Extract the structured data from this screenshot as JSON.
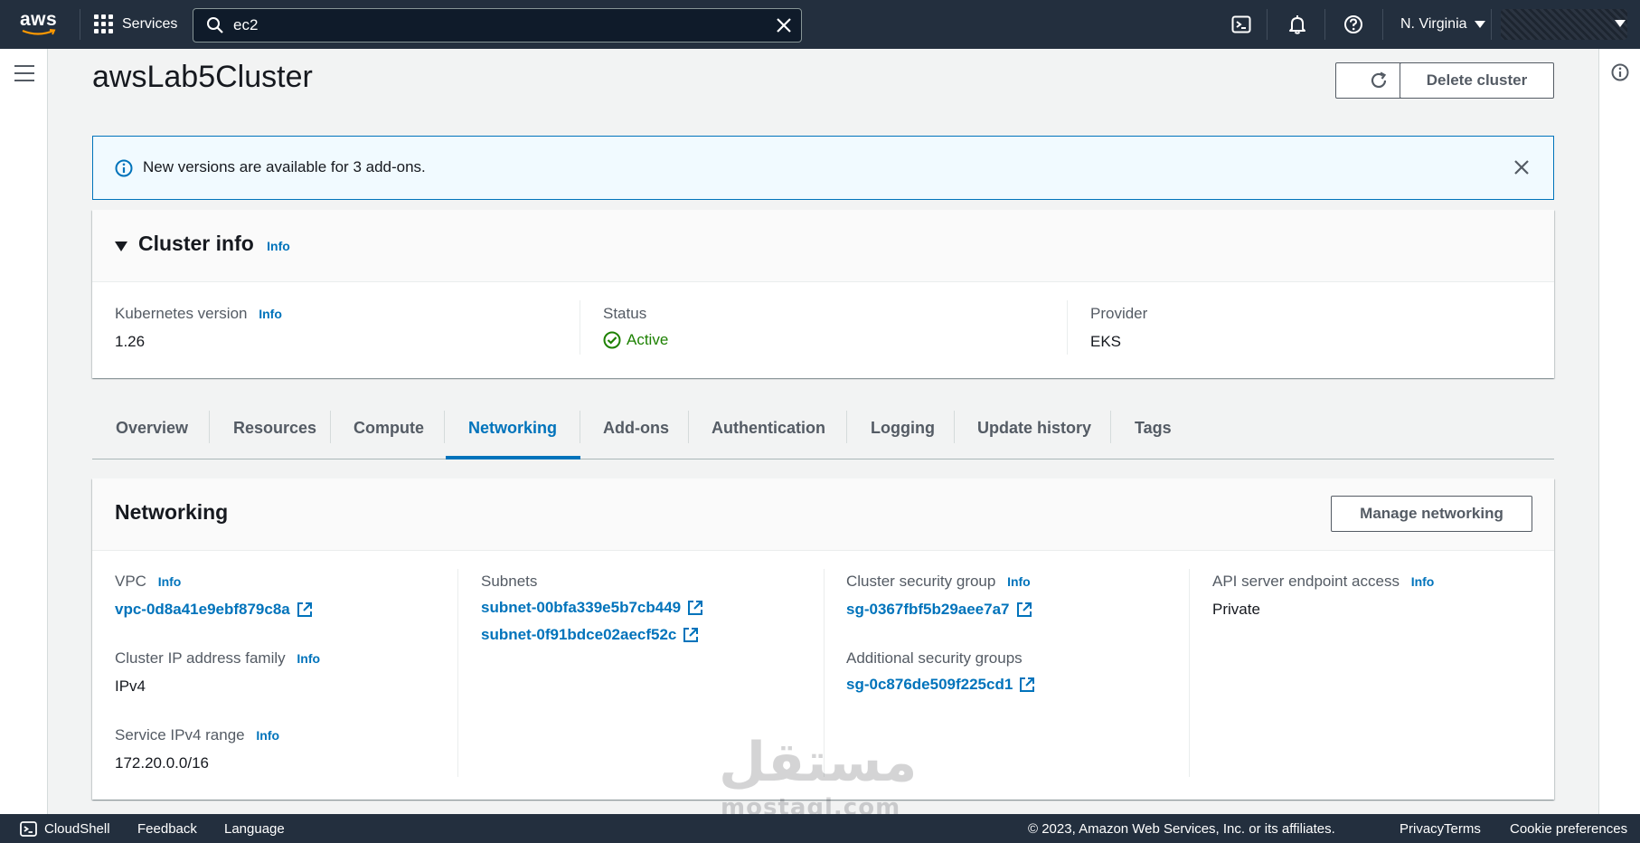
{
  "topnav": {
    "logo_text": "aws",
    "services_label": "Services",
    "search_value": "ec2",
    "region": "N. Virginia"
  },
  "page": {
    "title": "awsLab5Cluster",
    "delete_button": "Delete cluster"
  },
  "flash": {
    "message": "New versions are available for 3 add-ons."
  },
  "cluster_info": {
    "title": "Cluster info",
    "info": "Info",
    "k8s_label": "Kubernetes version",
    "k8s_value": "1.26",
    "status_label": "Status",
    "status_value": "Active",
    "provider_label": "Provider",
    "provider_value": "EKS"
  },
  "tabs": [
    "Overview",
    "Resources",
    "Compute",
    "Networking",
    "Add-ons",
    "Authentication",
    "Logging",
    "Update history",
    "Tags"
  ],
  "networking": {
    "title": "Networking",
    "manage_button": "Manage networking",
    "info": "Info",
    "vpc_label": "VPC",
    "vpc_value": "vpc-0d8a41e9ebf879c8a",
    "ip_family_label": "Cluster IP address family",
    "ip_family_value": "IPv4",
    "service_range_label": "Service IPv4 range",
    "service_range_value": "172.20.0.0/16",
    "subnets_label": "Subnets",
    "subnets": [
      "subnet-00bfa339e5b7cb449",
      "subnet-0f91bdce02aecf52c"
    ],
    "sg_label": "Cluster security group",
    "sg_value": "sg-0367fbf5b29aee7a7",
    "additional_sg_label": "Additional security groups",
    "additional_sg_value": "sg-0c876de509f225cd1",
    "api_label": "API server endpoint access",
    "api_value": "Private"
  },
  "footer": {
    "cloudshell": "CloudShell",
    "feedback": "Feedback",
    "language": "Language",
    "copyright": "© 2023, Amazon Web Services, Inc. or its affiliates.",
    "privacy": "Privacy",
    "terms": "Terms",
    "cookies": "Cookie preferences"
  },
  "watermark": {
    "arabic": "مستقل",
    "latin": "mostaql.com"
  },
  "colors": {
    "nav_bg": "#232f3e",
    "link": "#0073bb",
    "success": "#1d8102",
    "flash_bg": "#f1faff"
  },
  "icons": [
    "aws-logo",
    "grid-icon",
    "search-icon",
    "clear-icon",
    "cloudshell-icon",
    "bell-icon",
    "help-icon",
    "caret-down-icon",
    "hamburger-icon",
    "info-circle-icon",
    "refresh-icon",
    "close-icon",
    "check-circle-icon",
    "external-link-icon"
  ]
}
